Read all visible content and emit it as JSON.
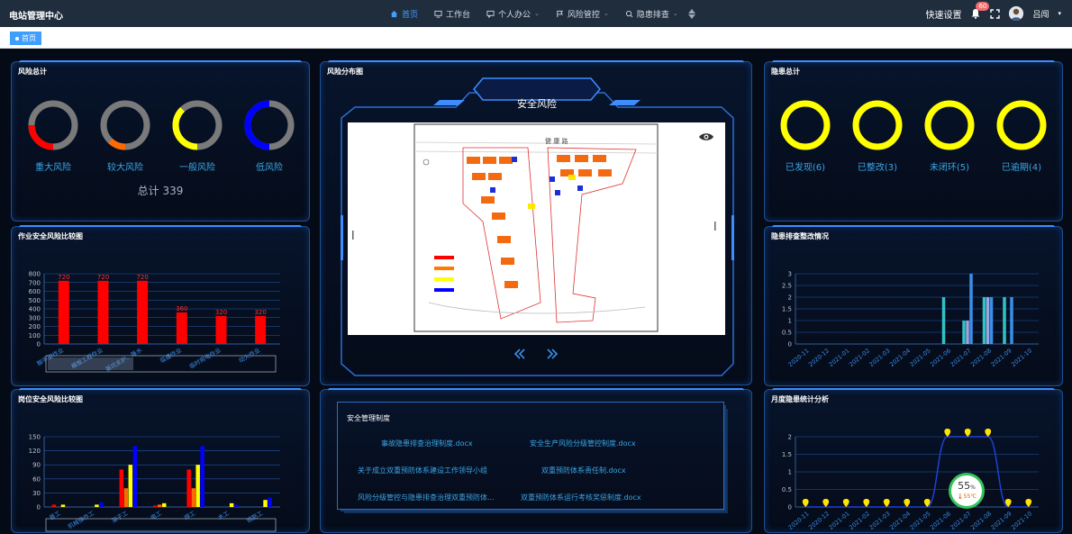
{
  "app": {
    "title": "电站管理中心"
  },
  "nav": [
    {
      "label": "首页",
      "icon": "home-icon",
      "active": true,
      "dropdown": false
    },
    {
      "label": "工作台",
      "icon": "monitor-icon",
      "active": false,
      "dropdown": false
    },
    {
      "label": "个人办公",
      "icon": "chat-icon",
      "active": false,
      "dropdown": true
    },
    {
      "label": "风险管控",
      "icon": "flag-icon",
      "active": false,
      "dropdown": true
    },
    {
      "label": "隐患排查",
      "icon": "search-doc-icon",
      "active": false,
      "dropdown": true
    }
  ],
  "header": {
    "quick_settings": "快速设置",
    "notification_count": "60",
    "user_name": "吕闯"
  },
  "tabs": [
    {
      "label": "首页"
    }
  ],
  "risk_total": {
    "title": "风险总计",
    "rings": [
      {
        "label": "重大风险",
        "color": "#ff0000",
        "fraction": 0.25
      },
      {
        "label": "较大风险",
        "color": "#ff6a00",
        "fraction": 0.12
      },
      {
        "label": "一般风险",
        "color": "#ffff00",
        "fraction": 0.38
      },
      {
        "label": "低风险",
        "color": "#0000ff",
        "fraction": 0.5
      }
    ],
    "total_label": "总计 339"
  },
  "risk_map": {
    "title": "风险分布图",
    "banner": "安全风险",
    "road_label": "健 康 路",
    "legend_colors": [
      "#ff0000",
      "#ff7a00",
      "#ffff00",
      "#0000ff"
    ]
  },
  "hazard_total": {
    "title": "隐患总计",
    "rings": [
      {
        "label": "已发现(6)",
        "color": "#ffff00"
      },
      {
        "label": "已整改(3)",
        "color": "#ffff00"
      },
      {
        "label": "未闭环(5)",
        "color": "#ffff00"
      },
      {
        "label": "已逾期(4)",
        "color": "#ffff00"
      }
    ]
  },
  "safety_docs": {
    "title": "安全管理制度",
    "items": [
      "事故隐患排查治理制度.docx",
      "安全生产风险分级管控制度.docx",
      "关于成立双重预防体系建设工作领导小组",
      "双重预防体系责任制.docx",
      "风险分级管控与隐患排查治理双重预防体...",
      "双重预防体系运行考核奖惩制度.docx"
    ]
  },
  "chart_data": [
    {
      "id": "work-risk",
      "title": "作业安全风险比较图",
      "type": "bar",
      "categories": [
        "脚手架作业",
        "模板工程作业",
        "基坑支护、降水",
        "临建作业",
        "临时用电作业",
        "动火作业"
      ],
      "values": [
        720,
        720,
        720,
        360,
        320,
        320
      ],
      "data_labels": [
        "720",
        "720",
        "720",
        "360",
        "320",
        "320"
      ],
      "ylim": [
        0,
        800
      ],
      "yticks": [
        0,
        100,
        200,
        300,
        400,
        500,
        600,
        700,
        800
      ],
      "color": "#ff0000"
    },
    {
      "id": "post-risk",
      "title": "岗位安全风险比较图",
      "type": "bar",
      "categories": [
        "普工",
        "机械操作工",
        "架子工",
        "电工",
        "焊工",
        "木工",
        "钢筋工"
      ],
      "series": [
        {
          "color": "#ff0000",
          "values": [
            5,
            0,
            80,
            3,
            80,
            0,
            0
          ]
        },
        {
          "color": "#ff6a00",
          "values": [
            0,
            0,
            40,
            5,
            40,
            0,
            0
          ]
        },
        {
          "color": "#ffff00",
          "values": [
            5,
            5,
            90,
            8,
            90,
            8,
            15
          ]
        },
        {
          "color": "#0000ff",
          "values": [
            0,
            10,
            130,
            0,
            130,
            5,
            20
          ]
        }
      ],
      "ylim": [
        0,
        150
      ],
      "yticks": [
        0,
        30,
        60,
        90,
        120,
        150
      ]
    },
    {
      "id": "hazard-rectify",
      "title": "隐患排查整改情况",
      "type": "bar",
      "categories": [
        "2020-11",
        "2020-12",
        "2021-01",
        "2021-02",
        "2021-03",
        "2021-04",
        "2021-05",
        "2021-06",
        "2021-07",
        "2021-08",
        "2021-09",
        "2021-10"
      ],
      "series": [
        {
          "color": "#2fc4c4",
          "values": [
            0,
            0,
            0,
            0,
            0,
            0,
            0,
            2,
            1,
            2,
            2,
            0
          ]
        },
        {
          "color": "#9aa7e0",
          "values": [
            0,
            0,
            0,
            0,
            0,
            0,
            0,
            0,
            1,
            2,
            0,
            0
          ]
        },
        {
          "color": "#3a8fe8",
          "values": [
            0,
            0,
            0,
            0,
            0,
            0,
            0,
            0,
            3,
            2,
            2,
            0
          ]
        }
      ],
      "ylim": [
        0,
        3
      ],
      "yticks": [
        0,
        0.5,
        1,
        1.5,
        2,
        2.5,
        3
      ]
    },
    {
      "id": "monthly-hazard",
      "title": "月度隐患统计分析",
      "type": "line",
      "categories": [
        "2020-11",
        "2020-12",
        "2021-01",
        "2021-02",
        "2021-03",
        "2021-04",
        "2021-05",
        "2021-06",
        "2021-07",
        "2021-08",
        "2021-09",
        "2021-10"
      ],
      "values": [
        0,
        0,
        0,
        0,
        0,
        0,
        0,
        2,
        2,
        2,
        0,
        0
      ],
      "ylim": [
        0,
        2
      ],
      "yticks": [
        0,
        0.5,
        1,
        1.5,
        2
      ],
      "color": "#1f3fd8",
      "marker_color": "#ffe400"
    }
  ],
  "gauge": {
    "percent": "55",
    "unit": "%",
    "temp": "55℃"
  }
}
